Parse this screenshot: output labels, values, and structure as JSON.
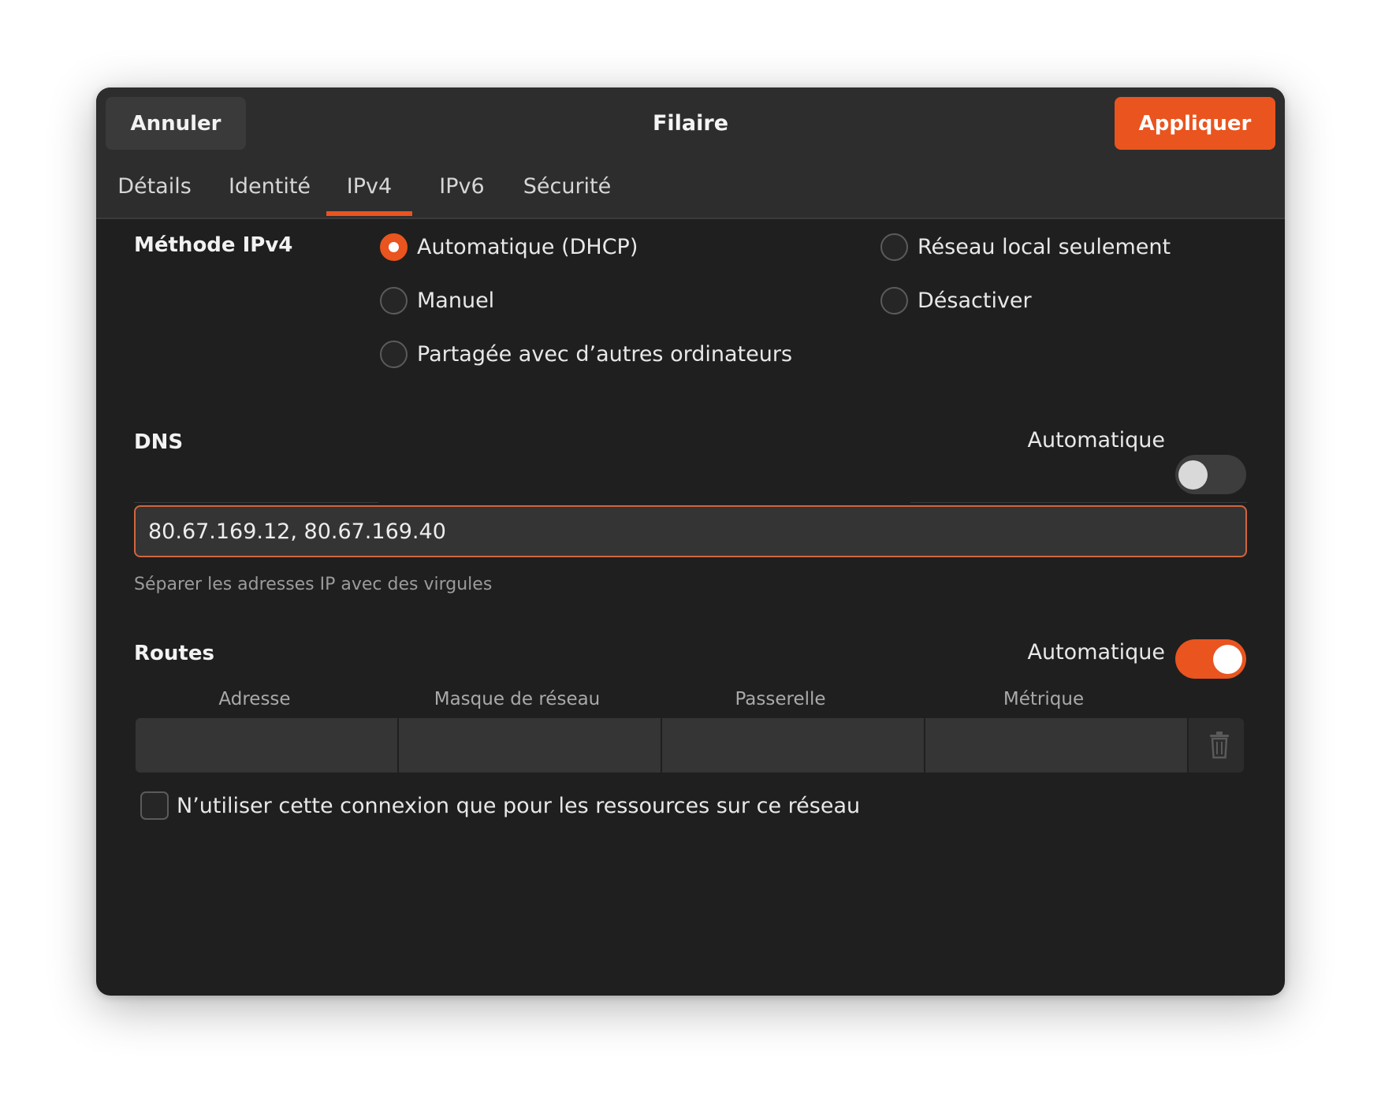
{
  "header": {
    "cancel_label": "Annuler",
    "title": "Filaire",
    "apply_label": "Appliquer"
  },
  "tabs": [
    {
      "label": "Détails",
      "active": false
    },
    {
      "label": "Identité",
      "active": false
    },
    {
      "label": "IPv4",
      "active": true
    },
    {
      "label": "IPv6",
      "active": false
    },
    {
      "label": "Sécurité",
      "active": false
    }
  ],
  "method": {
    "label": "Méthode IPv4",
    "options": [
      {
        "label": "Automatique (DHCP)",
        "checked": true
      },
      {
        "label": "Réseau local seulement",
        "checked": false
      },
      {
        "label": "Manuel",
        "checked": false
      },
      {
        "label": "Désactiver",
        "checked": false
      },
      {
        "label": "Partagée avec d’autres ordinateurs",
        "checked": false
      }
    ]
  },
  "dns": {
    "label": "DNS",
    "auto_label": "Automatique",
    "auto_enabled": false,
    "value": "80.67.169.12, 80.67.169.40",
    "hint": "Séparer les adresses IP avec des virgules"
  },
  "routes": {
    "label": "Routes",
    "auto_label": "Automatique",
    "auto_enabled": true,
    "columns": [
      "Adresse",
      "Masque de réseau",
      "Passerelle",
      "Métrique"
    ],
    "row": [
      "",
      "",
      "",
      ""
    ]
  },
  "only_local": {
    "label": "N’utiliser cette connexion que pour les ressources sur ce réseau",
    "checked": false
  },
  "colors": {
    "accent": "#e9541f",
    "window_bg": "#1f1f1f",
    "header_bg": "#2d2d2d"
  }
}
